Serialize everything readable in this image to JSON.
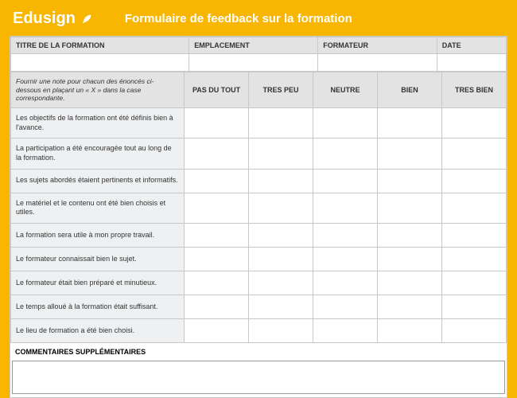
{
  "brand": "Edusign",
  "title": "Formulaire de feedback sur la formation",
  "meta": {
    "col1": "TITRE DE LA FORMATION",
    "col2": "EMPLACEMENT",
    "col3": "FORMATEUR",
    "col4": "DATE"
  },
  "instruction": "Fournir une note pour chacun des énoncés ci-dessous en plaçant un « X » dans la case correspondante.",
  "scale": {
    "c1": "PAS DU TOUT",
    "c2": "TRES PEU",
    "c3": "NEUTRE",
    "c4": "BIEN",
    "c5": "TRES BIEN"
  },
  "questions": {
    "q1": "Les objectifs de la formation ont été définis bien à l'avance.",
    "q2": "La participation a été encouragée tout au long de la formation.",
    "q3": "Les sujets abordés étaient pertinents et informatifs.",
    "q4": "Le matériel et le contenu ont été bien choisis et utiles.",
    "q5": "La formation sera utile à mon propre travail.",
    "q6": "Le formateur connaissait bien le sujet.",
    "q7": "Le formateur était bien préparé et minutieux.",
    "q8": "Le temps alloué à la formation était suffisant.",
    "q9": "Le lieu de formation a été bien choisi."
  },
  "comments_label": "COMMENTAIRES SUPPLÉMENTAIRES"
}
